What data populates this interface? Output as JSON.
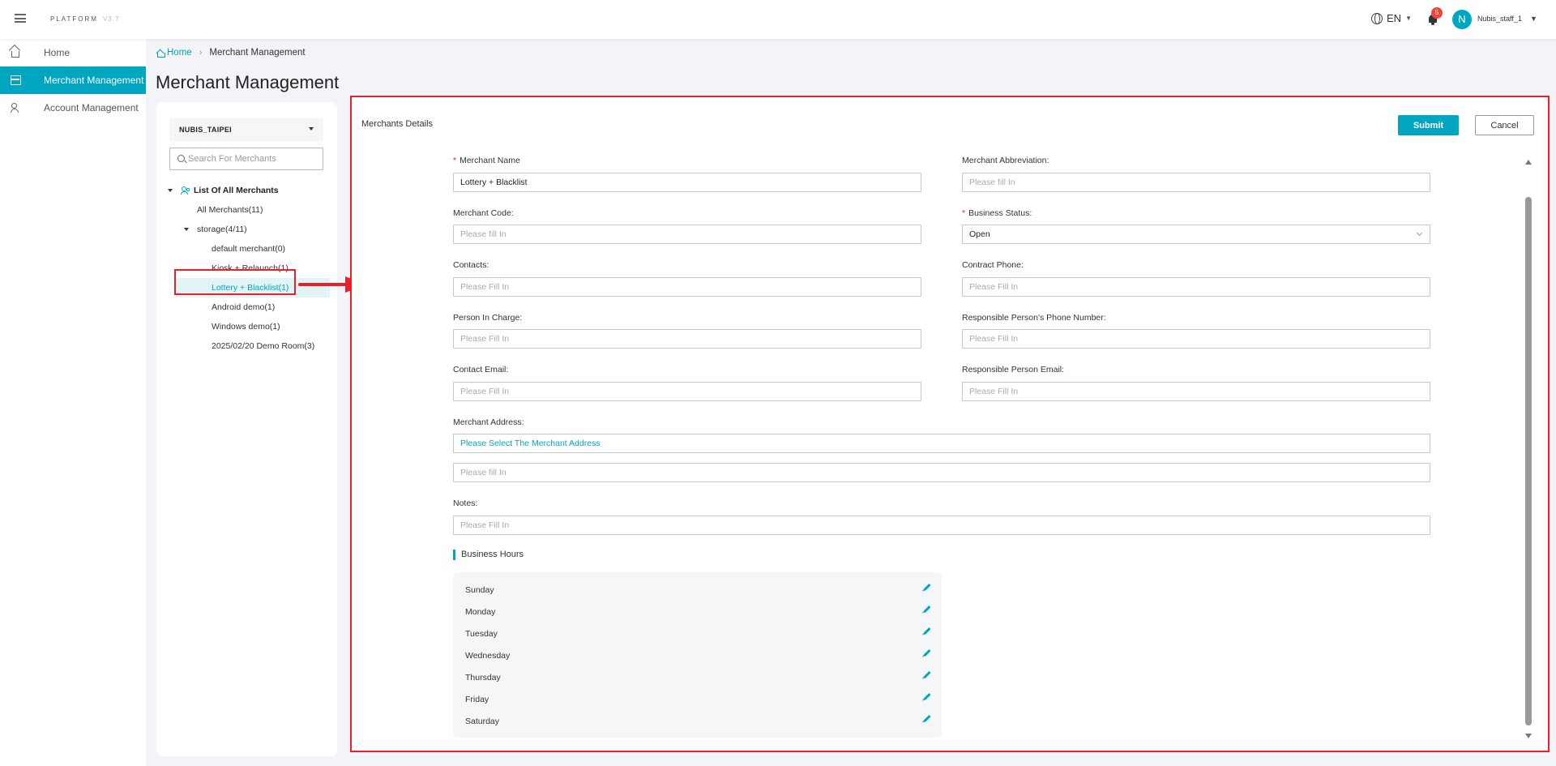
{
  "header": {
    "logo": "PLATFORM",
    "version": "V3.7",
    "language": "EN",
    "notification_count": "5",
    "avatar_letter": "N",
    "username": "Nubis_staff_1"
  },
  "sidebar": {
    "items": [
      {
        "label": "Home"
      },
      {
        "label": "Merchant Management"
      },
      {
        "label": "Account Management"
      }
    ]
  },
  "breadcrumb": {
    "home": "Home",
    "current": "Merchant Management"
  },
  "page_title": "Merchant Management",
  "left_panel": {
    "merchant_selected": "NUBIS_TAIPEI",
    "search_placeholder": "Search For Merchants",
    "tree": {
      "root": "List Of All Merchants",
      "all": "All Merchants(11)",
      "group": "storage(4/11)",
      "children": [
        "default merchant(0)",
        "Kiosk + Relaunch(1)",
        "Lottery + Blacklist(1)",
        "Android demo(1)",
        "Windows demo(1)",
        "2025/02/20 Demo Room(3)"
      ]
    }
  },
  "form": {
    "section_title": "Merchants Details",
    "submit_label": "Submit",
    "cancel_label": "Cancel",
    "merchant_name": {
      "label": "Merchant Name",
      "value": "Lottery + Blacklist"
    },
    "merchant_abbreviation": {
      "label": "Merchant Abbreviation:",
      "placeholder": "Please fill In"
    },
    "merchant_code": {
      "label": "Merchant Code:",
      "placeholder": "Please fill In"
    },
    "business_status": {
      "label": "Business Status:",
      "value": "Open"
    },
    "contacts": {
      "label": "Contacts:",
      "placeholder": "Please Fill In"
    },
    "contract_phone": {
      "label": "Contract Phone:",
      "placeholder": "Please Fill In"
    },
    "person_in_charge": {
      "label": "Person In Charge:",
      "placeholder": "Please Fill In"
    },
    "responsible_phone": {
      "label": "Responsible Person's Phone Number:",
      "placeholder": "Please Fill In"
    },
    "contact_email": {
      "label": "Contact Email:",
      "placeholder": "Please Fill In"
    },
    "responsible_email": {
      "label": "Responsible Person Email:",
      "placeholder": "Please Fill In"
    },
    "merchant_address": {
      "label": "Merchant Address:",
      "select_text": "Please Select The Merchant Address",
      "detail_placeholder": "Please fill In"
    },
    "notes": {
      "label": "Notes:",
      "placeholder": "Please Fill In"
    },
    "business_hours": {
      "title": "Business Hours",
      "days": [
        "Sunday",
        "Monday",
        "Tuesday",
        "Wednesday",
        "Thursday",
        "Friday",
        "Saturday"
      ]
    }
  },
  "colors": {
    "accent": "#00a6bf",
    "annotation": "#e8202a"
  }
}
